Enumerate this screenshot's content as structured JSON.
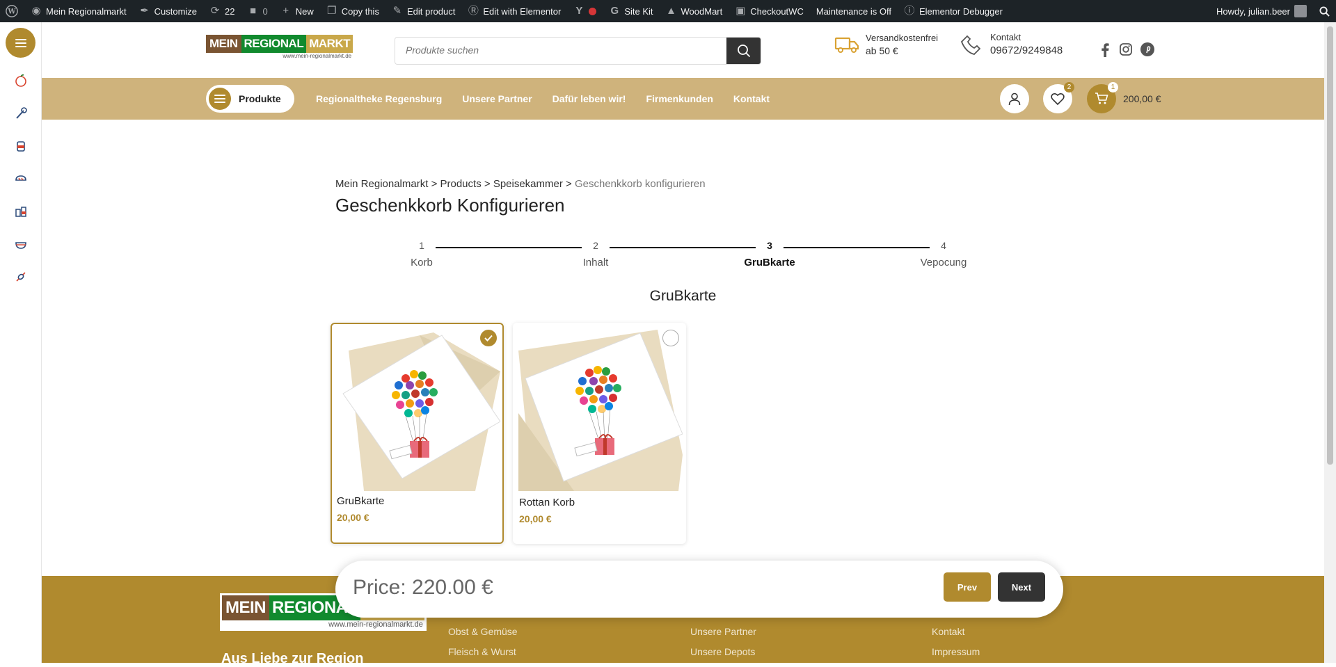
{
  "adminbar": {
    "site_name": "Mein Regionalmarkt",
    "customize": "Customize",
    "updates_count": "22",
    "comments_count": "0",
    "new_label": "New",
    "copy_this": "Copy this",
    "edit_product": "Edit product",
    "edit_elementor": "Edit with Elementor",
    "site_kit": "Site Kit",
    "woodmart": "WoodMart",
    "checkoutwc": "CheckoutWC",
    "maintenance": "Maintenance is Off",
    "elementor_debugger": "Elementor Debugger",
    "howdy": "Howdy, julian.beer"
  },
  "header": {
    "logo": {
      "mein": "MEIN",
      "regional": "REGIONAL",
      "markt": "MARKT",
      "url": "www.mein-regionalmarkt.de"
    },
    "search_placeholder": "Produkte suchen",
    "shipping_line1": "Versandkostenfrei",
    "shipping_line2": "ab 50 €",
    "contact_line1": "Kontakt",
    "contact_phone": "09672/9249848",
    "social_icons": [
      "facebook-icon",
      "instagram-icon",
      "pinterest-icon"
    ]
  },
  "nav": {
    "products_button": "Produkte",
    "links": [
      "Regionaltheke Regensburg",
      "Unsere Partner",
      "Dafür leben wir!",
      "Firmenkunden",
      "Kontakt"
    ],
    "wishlist_count": "2",
    "cart_count": "1",
    "cart_total": "200,00 €"
  },
  "breadcrumb": {
    "items": [
      "Mein Regionalmarkt",
      "Products",
      "Speisekammer"
    ],
    "separator": ">",
    "current": "Geschenkkorb konfigurieren"
  },
  "page_title": "Geschenkkorb Konfigurieren",
  "steps": [
    {
      "num": "1",
      "label": "Korb"
    },
    {
      "num": "2",
      "label": "Inhalt"
    },
    {
      "num": "3",
      "label": "GruBkarte"
    },
    {
      "num": "4",
      "label": "Vepocung"
    }
  ],
  "active_step": 3,
  "section_title": "GruBkarte",
  "products": [
    {
      "name": "GruBkarte",
      "price": "20,00 €",
      "selected": true
    },
    {
      "name": "Rottan Korb",
      "price": "20,00 €",
      "selected": false
    }
  ],
  "pricebar": {
    "price": "Price: 220.00 €",
    "prev": "Prev",
    "next": "Next"
  },
  "footer": {
    "col1": [
      "Obst & Gemüse",
      "Fleisch & Wurst"
    ],
    "col2": [
      "Unsere Partner",
      "Unsere Depots"
    ],
    "col3": [
      "Kontakt",
      "Impressum"
    ],
    "tagline": "Aus Liebe zur Region"
  },
  "colors": {
    "brand_gold": "#b08a2e",
    "nav_bg": "#cfb37c",
    "admin_bg": "#1d2327",
    "dark_button": "#333333"
  }
}
